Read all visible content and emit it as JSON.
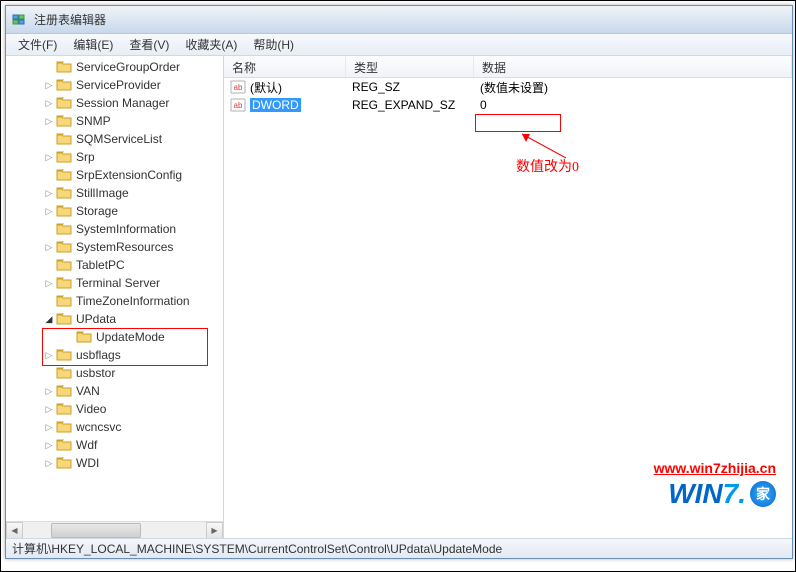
{
  "window": {
    "title": "注册表编辑器"
  },
  "menu": {
    "file": "文件(F)",
    "edit": "编辑(E)",
    "view": "查看(V)",
    "favorites": "收藏夹(A)",
    "help": "帮助(H)"
  },
  "tree": {
    "items": [
      {
        "label": "ServiceGroupOrder",
        "expander": ""
      },
      {
        "label": "ServiceProvider",
        "expander": "▷"
      },
      {
        "label": "Session Manager",
        "expander": "▷"
      },
      {
        "label": "SNMP",
        "expander": "▷"
      },
      {
        "label": "SQMServiceList",
        "expander": ""
      },
      {
        "label": "Srp",
        "expander": "▷"
      },
      {
        "label": "SrpExtensionConfig",
        "expander": ""
      },
      {
        "label": "StillImage",
        "expander": "▷"
      },
      {
        "label": "Storage",
        "expander": "▷"
      },
      {
        "label": "SystemInformation",
        "expander": ""
      },
      {
        "label": "SystemResources",
        "expander": "▷"
      },
      {
        "label": "TabletPC",
        "expander": ""
      },
      {
        "label": "Terminal Server",
        "expander": "▷"
      },
      {
        "label": "TimeZoneInformation",
        "expander": ""
      },
      {
        "label": "UPdata",
        "expander": "◢",
        "expanded": true
      },
      {
        "label": "UpdateMode",
        "expander": "",
        "child": true
      },
      {
        "label": "usbflags",
        "expander": "▷"
      },
      {
        "label": "usbstor",
        "expander": ""
      },
      {
        "label": "VAN",
        "expander": "▷"
      },
      {
        "label": "Video",
        "expander": "▷"
      },
      {
        "label": "wcncsvc",
        "expander": "▷"
      },
      {
        "label": "Wdf",
        "expander": "▷"
      },
      {
        "label": "WDI",
        "expander": "▷"
      }
    ]
  },
  "list": {
    "headers": {
      "name": "名称",
      "type": "类型",
      "data": "数据"
    },
    "rows": [
      {
        "name": "(默认)",
        "type": "REG_SZ",
        "data": "(数值未设置)",
        "icon": "ab"
      },
      {
        "name": "DWORD",
        "type": "REG_EXPAND_SZ",
        "data": "0",
        "icon": "ab",
        "selected": true
      }
    ]
  },
  "annotation": {
    "text": "数值改为0"
  },
  "statusbar": {
    "path": "计算机\\HKEY_LOCAL_MACHINE\\SYSTEM\\CurrentControlSet\\Control\\UPdata\\UpdateMode"
  },
  "watermark": {
    "url": "www.win7zhijia.cn",
    "logo_prefix": "WIN",
    "logo_suffix": "7.",
    "badge": "家"
  }
}
